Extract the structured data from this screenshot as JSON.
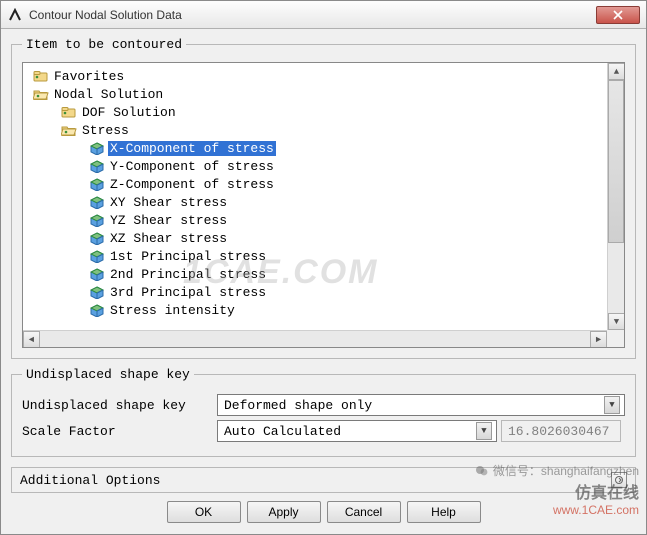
{
  "window": {
    "title": "Contour Nodal Solution Data"
  },
  "group1": {
    "legend": "Item to be contoured"
  },
  "tree": {
    "items": [
      {
        "indent": 0,
        "icon": "folder",
        "label": "Favorites",
        "selected": false
      },
      {
        "indent": 0,
        "icon": "folder-open",
        "label": "Nodal Solution",
        "selected": false
      },
      {
        "indent": 1,
        "icon": "folder",
        "label": "DOF Solution",
        "selected": false
      },
      {
        "indent": 1,
        "icon": "folder-open",
        "label": "Stress",
        "selected": false
      },
      {
        "indent": 2,
        "icon": "cube",
        "label": "X-Component of stress",
        "selected": true
      },
      {
        "indent": 2,
        "icon": "cube",
        "label": "Y-Component of stress",
        "selected": false
      },
      {
        "indent": 2,
        "icon": "cube",
        "label": "Z-Component of stress",
        "selected": false
      },
      {
        "indent": 2,
        "icon": "cube",
        "label": "XY Shear stress",
        "selected": false
      },
      {
        "indent": 2,
        "icon": "cube",
        "label": "YZ Shear stress",
        "selected": false
      },
      {
        "indent": 2,
        "icon": "cube",
        "label": "XZ Shear stress",
        "selected": false
      },
      {
        "indent": 2,
        "icon": "cube",
        "label": "1st Principal stress",
        "selected": false
      },
      {
        "indent": 2,
        "icon": "cube",
        "label": "2nd Principal stress",
        "selected": false
      },
      {
        "indent": 2,
        "icon": "cube",
        "label": "3rd Principal stress",
        "selected": false
      },
      {
        "indent": 2,
        "icon": "cube",
        "label": "Stress intensity",
        "selected": false
      }
    ]
  },
  "group2": {
    "legend": "Undisplaced shape key",
    "row1_label": "Undisplaced shape key",
    "row1_value": "Deformed shape only",
    "row2_label": "Scale Factor",
    "row2_value": "Auto Calculated",
    "row2_readonly": "16.8026030467"
  },
  "addopts": {
    "label": "Additional Options"
  },
  "buttons": {
    "ok": "OK",
    "apply": "Apply",
    "cancel": "Cancel",
    "help": "Help"
  },
  "watermarks": {
    "center": "1CAE.COM",
    "bottom_text1": "微信号：shanghaifangzhen",
    "bottom_text2": "仿真在线",
    "bottom_url": "www.1CAE.com"
  }
}
